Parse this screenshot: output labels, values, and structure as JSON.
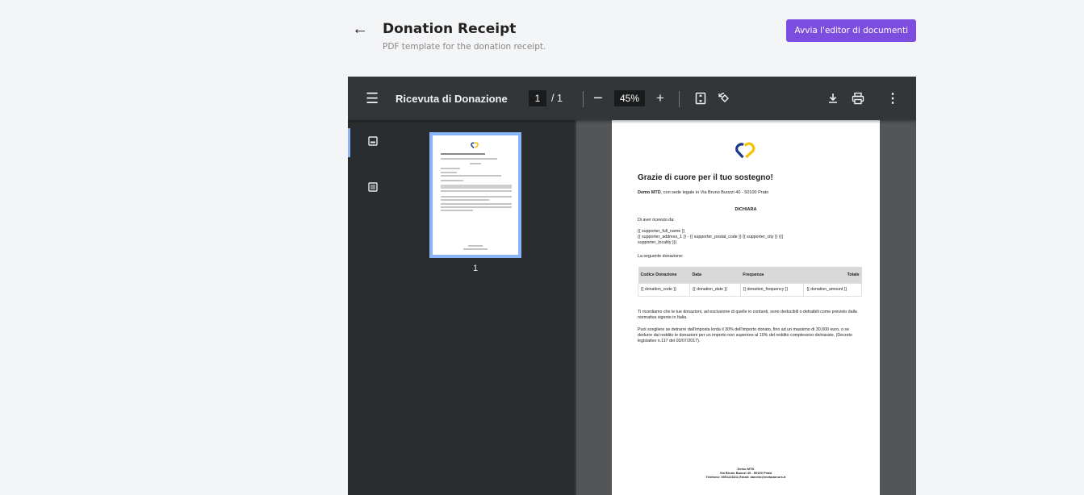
{
  "header": {
    "title": "Donation Receipt",
    "subtitle": "PDF template for the donation receipt.",
    "editor_button": "Avvia l'editor di documenti",
    "back_icon": "arrow-left-icon"
  },
  "viewer": {
    "doc_title": "Ricevuta di Donazione",
    "page_current": "1",
    "page_total_label": "/ 1",
    "zoom_value": "45%",
    "zoom_out_label": "−",
    "zoom_in_label": "+",
    "thumbnail_page_number": "1"
  },
  "document": {
    "heading": "Grazie di cuore per il tuo sostegno!",
    "org_name": "Demo MTD",
    "org_address": ", con sede legale in Via Bruno Buozzi 40 - 50100 Prato",
    "dichiara": "DICHIARA",
    "received_from": "Di aver ricevuto da:",
    "supporter_block_1": "{{ supporter_full_name }}",
    "supporter_block_2": "{{ supporter_address_1 }} - {{ supporter_postal_code }} {{ supporter_city }} ({{",
    "supporter_block_3": "supporter_locality }})",
    "following_donation": "La seguente donazione:",
    "table_headers": [
      "Codice Donazione",
      "Data",
      "Frequenza",
      "Totale"
    ],
    "table_row": [
      "{{ donation_code }}",
      "{{ donation_date }}",
      "{{ donation_frequency }}",
      "{{ donation_amount }}"
    ],
    "paragraph_1": "Ti ricordiamo che le tue donazioni, ad esclusione di quelle in contanti, sono deducibili o detraibili come previsto dalla normativa vigente in Italia.",
    "paragraph_2": "Puoi scegliere se detrarre dall'imposta lorda il 30% dell'importo donato, fino ad un massimo di 30.000 euro, o se dedurre dal reddito le donazioni per un importo non superiore al 10% del reddito complessivo dichiarato. (Decreto legislativo n.117 del 03/07/2017).",
    "footer_line_1": "Demo MTD",
    "footer_line_2": "Via Bruno Buozzi 40 - 50100 Prato",
    "footer_line_3": "Telefono: 0551123211 Email: daniele@metadonors.it"
  },
  "colors": {
    "accent": "#7c4ddf",
    "viewer_bg": "#323639",
    "selection": "#8ab4f8",
    "logo_blue": "#1a3b8c",
    "logo_yellow": "#f5c400"
  }
}
